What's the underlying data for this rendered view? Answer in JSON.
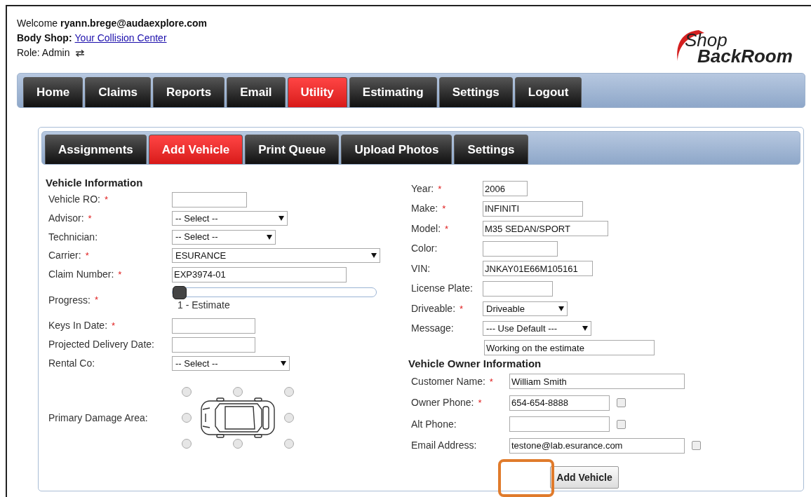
{
  "header": {
    "welcome": "Welcome",
    "user": "ryann.brege@audaexplore.com",
    "body_shop_label": "Body Shop:",
    "body_shop_link": "Your Collision Center",
    "role": "Role: Admin"
  },
  "logo": {
    "line1": "Shop",
    "line2": "BackRoom"
  },
  "main_tabs": [
    {
      "label": "Home",
      "selected": false
    },
    {
      "label": "Claims",
      "selected": false
    },
    {
      "label": "Reports",
      "selected": false
    },
    {
      "label": "Email",
      "selected": false
    },
    {
      "label": "Utility",
      "selected": true
    },
    {
      "label": "Estimating",
      "selected": false
    },
    {
      "label": "Settings",
      "selected": false
    },
    {
      "label": "Logout",
      "selected": false
    }
  ],
  "sub_tabs": [
    {
      "label": "Assignments",
      "selected": false
    },
    {
      "label": "Add Vehicle",
      "selected": true
    },
    {
      "label": "Print Queue",
      "selected": false
    },
    {
      "label": "Upload Photos",
      "selected": false
    },
    {
      "label": "Settings",
      "selected": false
    }
  ],
  "vehicle_info": {
    "title": "Vehicle Information",
    "fields": [
      {
        "kind": "text",
        "label": "Vehicle RO:",
        "required_mark": "*"
      },
      {
        "kind": "select",
        "label": "Advisor:",
        "required_mark": "*",
        "value": "-- Select --"
      },
      {
        "kind": "select",
        "label": "Technician:",
        "value": "-- Select --"
      },
      {
        "kind": "select",
        "label": "Carrier:",
        "required_mark": "*",
        "value": "ESURANCE"
      },
      {
        "kind": "text",
        "label": "Claim Number:",
        "required_mark": "*",
        "value": "EXP3974-01"
      },
      {
        "kind": "slider",
        "label": "Progress:",
        "required_mark": "*",
        "level": 0,
        "reading": "1 - Estimate"
      },
      {
        "kind": "text",
        "label": "Keys In Date:",
        "required_mark": "*"
      },
      {
        "kind": "text",
        "label": "Projected Delivery Date:"
      },
      {
        "kind": "select",
        "label": "Rental Co:",
        "value": "-- Select --"
      },
      {
        "kind": "damage",
        "label": "Primary Damage Area:",
        "options": [
          {
            "selected": false
          },
          {
            "selected": false
          },
          {
            "selected": false
          },
          {
            "selected": false
          },
          {
            "selected": false
          },
          {
            "selected": false
          },
          {
            "selected": false
          },
          {
            "selected": false
          }
        ]
      }
    ]
  },
  "vehicle_details": {
    "fields": [
      {
        "kind": "text",
        "label": "Year:",
        "required_mark": "*",
        "value": "2006"
      },
      {
        "kind": "text",
        "label": "Make:",
        "required_mark": "*",
        "value": "INFINITI"
      },
      {
        "kind": "text",
        "label": "Model:",
        "required_mark": "*",
        "value": "M35 SEDAN/SPORT"
      },
      {
        "kind": "text",
        "label": "Color:"
      },
      {
        "kind": "text",
        "label": "VIN:",
        "value": "JNKAY01E66M105161"
      },
      {
        "kind": "text",
        "label": "License Plate:"
      },
      {
        "kind": "select",
        "label": "Driveable:",
        "required_mark": "*",
        "value": "Driveable"
      },
      {
        "kind": "select",
        "label": "Message:",
        "value": "--- Use Default ---",
        "note": "Working on the estimate"
      }
    ]
  },
  "owner_info": {
    "title": "Vehicle Owner Information",
    "fields": [
      {
        "label": "Customer Name:",
        "required_mark": "*",
        "value": "William Smith"
      },
      {
        "label": "Owner Phone:",
        "required_mark": "*",
        "value": "654-654-8888",
        "checked": false
      },
      {
        "label": "Alt Phone:",
        "checked": false
      },
      {
        "label": "Email Address:",
        "value": "testone@lab.esurance.com",
        "checked": false
      }
    ]
  },
  "submit_button": "Add Vehicle",
  "highlight": true
}
